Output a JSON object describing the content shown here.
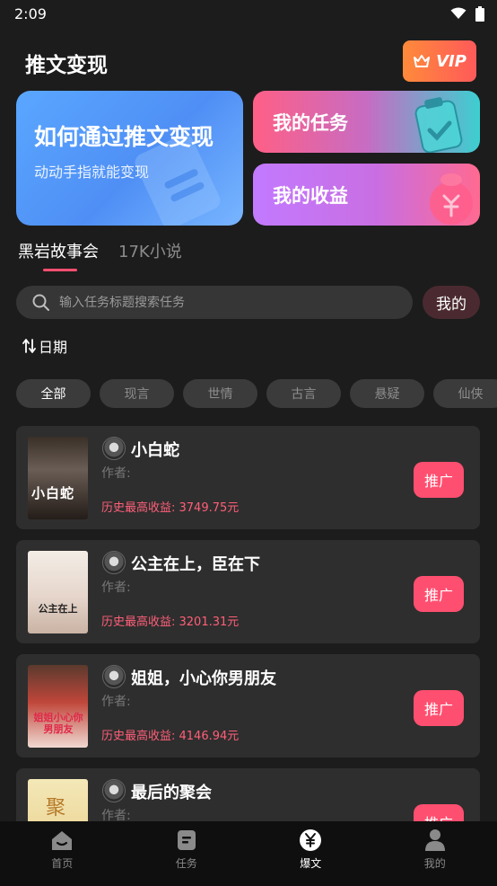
{
  "status_bar": {
    "time": "2:09"
  },
  "header": {
    "title": "推文变现",
    "vip_label": "VIP"
  },
  "banners": {
    "main": {
      "title": "如何通过推文变现",
      "subtitle": "动动手指就能变现"
    },
    "tasks": {
      "label": "我的任务"
    },
    "earnings": {
      "label": "我的收益"
    }
  },
  "tabs": [
    {
      "label": "黑岩故事会",
      "active": true
    },
    {
      "label": "17K小说",
      "active": false
    }
  ],
  "search": {
    "placeholder": "输入任务标题搜索任务",
    "mine_label": "我的"
  },
  "sort": {
    "label": "日期"
  },
  "chips": [
    {
      "label": "全部",
      "active": true
    },
    {
      "label": "现言",
      "active": false
    },
    {
      "label": "世情",
      "active": false
    },
    {
      "label": "古言",
      "active": false
    },
    {
      "label": "悬疑",
      "active": false
    },
    {
      "label": "仙侠",
      "active": false
    }
  ],
  "books": [
    {
      "title": "小白蛇",
      "author_label": "作者:",
      "earnings_text": "历史最高收益: 3749.75元",
      "button_label": "推广",
      "cover_text": "小白蛇"
    },
    {
      "title": "公主在上，臣在下",
      "author_label": "作者:",
      "earnings_text": "历史最高收益: 3201.31元",
      "button_label": "推广",
      "cover_text": "公主在上"
    },
    {
      "title": "姐姐，小心你男朋友",
      "author_label": "作者:",
      "earnings_text": "历史最高收益: 4146.94元",
      "button_label": "推广",
      "cover_text": "姐姐小心你男朋友"
    },
    {
      "title": "最后的聚会",
      "author_label": "作者:",
      "earnings_text": "",
      "button_label": "推广",
      "cover_text": "聚"
    }
  ],
  "bottom_nav": [
    {
      "label": "首页",
      "icon": "home-icon",
      "active": false
    },
    {
      "label": "任务",
      "icon": "task-icon",
      "active": false
    },
    {
      "label": "爆文",
      "icon": "yen-icon",
      "active": true
    },
    {
      "label": "我的",
      "icon": "person-icon",
      "active": false
    }
  ],
  "colors": {
    "accent": "#ff4f70",
    "background": "#1c1c1c",
    "card": "#2e2e2e"
  }
}
